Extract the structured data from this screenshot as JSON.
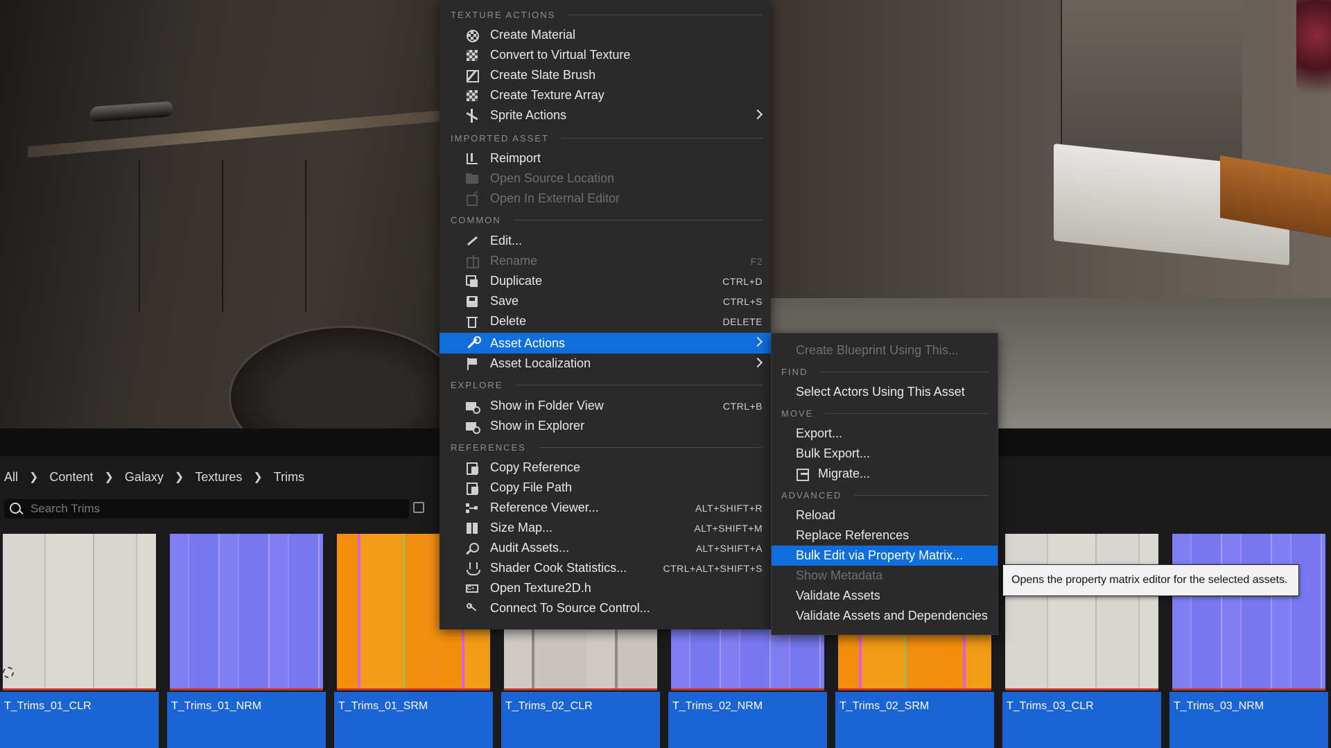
{
  "breadcrumb": [
    "All",
    "Content",
    "Galaxy",
    "Textures",
    "Trims"
  ],
  "search": {
    "placeholder": "Search Trims",
    "value": ""
  },
  "assets": [
    {
      "name": "T_Trims_01_CLR",
      "kind": "clr"
    },
    {
      "name": "T_Trims_01_NRM",
      "kind": "nrm"
    },
    {
      "name": "T_Trims_01_SRM",
      "kind": "srm"
    },
    {
      "name": "T_Trims_02_CLR",
      "kind": "clr"
    },
    {
      "name": "T_Trims_02_NRM",
      "kind": "nrm"
    },
    {
      "name": "T_Trims_02_SRM",
      "kind": "srm"
    },
    {
      "name": "T_Trims_03_CLR",
      "kind": "clr"
    },
    {
      "name": "T_Trims_03_NRM",
      "kind": "nrm"
    }
  ],
  "context_menu": {
    "sections": {
      "texture_actions": "TEXTURE ACTIONS",
      "imported_asset": "IMPORTED ASSET",
      "common": "COMMON",
      "explore": "EXPLORE",
      "references": "REFERENCES"
    },
    "items": {
      "create_material": {
        "label": "Create Material",
        "icon": "material-ball-icon"
      },
      "convert_virtual": {
        "label": "Convert to Virtual Texture",
        "icon": "checker-icon"
      },
      "create_slate_brush": {
        "label": "Create Slate Brush",
        "icon": "brush-icon"
      },
      "create_texture_array": {
        "label": "Create Texture Array",
        "icon": "checker-icon"
      },
      "sprite_actions": {
        "label": "Sprite Actions",
        "icon": "sprite-icon"
      },
      "reimport": {
        "label": "Reimport",
        "icon": "reimport-icon"
      },
      "open_source_location": {
        "label": "Open Source Location",
        "icon": "folder-icon",
        "disabled": true
      },
      "open_external_editor": {
        "label": "Open In External Editor",
        "icon": "external-icon",
        "disabled": true
      },
      "edit": {
        "label": "Edit...",
        "icon": "pencil-icon"
      },
      "rename": {
        "label": "Rename",
        "shortcut": "F2",
        "icon": "rename-icon",
        "disabled": true
      },
      "duplicate": {
        "label": "Duplicate",
        "shortcut": "CTRL+D",
        "icon": "duplicate-icon"
      },
      "save": {
        "label": "Save",
        "shortcut": "CTRL+S",
        "icon": "save-icon"
      },
      "delete": {
        "label": "Delete",
        "shortcut": "DELETE",
        "icon": "trash-icon"
      },
      "asset_actions": {
        "label": "Asset Actions",
        "icon": "wrench-icon",
        "highlighted": true
      },
      "asset_localization": {
        "label": "Asset Localization",
        "icon": "flag-icon"
      },
      "show_folder_view": {
        "label": "Show in Folder View",
        "shortcut": "CTRL+B",
        "icon": "folder-view-icon"
      },
      "show_explorer": {
        "label": "Show in Explorer",
        "icon": "folder-view-icon"
      },
      "copy_reference": {
        "label": "Copy Reference",
        "icon": "copy-icon"
      },
      "copy_file_path": {
        "label": "Copy File Path",
        "icon": "copy-icon"
      },
      "reference_viewer": {
        "label": "Reference Viewer...",
        "shortcut": "ALT+SHIFT+R",
        "icon": "graph-icon"
      },
      "size_map": {
        "label": "Size Map...",
        "shortcut": "ALT+SHIFT+M",
        "icon": "size-map-icon"
      },
      "audit_assets": {
        "label": "Audit Assets...",
        "shortcut": "ALT+SHIFT+A",
        "icon": "audit-icon"
      },
      "shader_cook": {
        "label": "Shader Cook Statistics...",
        "shortcut": "CTRL+ALT+SHIFT+S",
        "icon": "shader-icon"
      },
      "open_texture2d": {
        "label": "Open Texture2D.h",
        "icon": "code-icon"
      },
      "connect_source_control": {
        "label": "Connect To Source Control...",
        "icon": "source-control-icon"
      }
    }
  },
  "submenu": {
    "sections": {
      "find": "FIND",
      "move": "MOVE",
      "advanced": "ADVANCED"
    },
    "items": {
      "create_blueprint": {
        "label": "Create Blueprint Using This...",
        "disabled": true
      },
      "select_actors": {
        "label": "Select Actors Using This Asset"
      },
      "export": {
        "label": "Export..."
      },
      "bulk_export": {
        "label": "Bulk Export..."
      },
      "migrate": {
        "label": "Migrate...",
        "icon": "migrate-icon"
      },
      "reload": {
        "label": "Reload"
      },
      "replace_references": {
        "label": "Replace References"
      },
      "bulk_edit": {
        "label": "Bulk Edit via Property Matrix...",
        "highlighted": true
      },
      "show_metadata": {
        "label": "Show Metadata",
        "disabled": true
      },
      "validate_assets": {
        "label": "Validate Assets"
      },
      "validate_dependencies": {
        "label": "Validate Assets and Dependencies"
      }
    }
  },
  "tooltip": "Opens the property matrix editor for the selected assets.",
  "colors": {
    "highlight": "#0f6edc",
    "tile_label": "#1a64d6",
    "menu_bg": "#2a2a2a"
  }
}
